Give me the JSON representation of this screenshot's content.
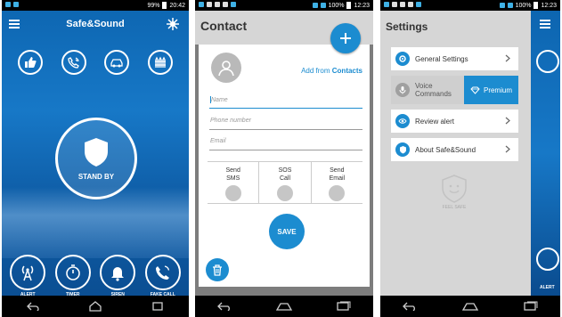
{
  "phone1": {
    "status": {
      "battery": "99%",
      "time": "20:42"
    },
    "app_title": "Safe&Sound",
    "standby_label": "STAND BY",
    "bottom_actions": [
      {
        "label": "ALERT",
        "icon": "antenna-icon"
      },
      {
        "label": "TIMER",
        "icon": "stopwatch-icon"
      },
      {
        "label": "SIREN",
        "icon": "bell-icon"
      },
      {
        "label": "FAKE CALL",
        "icon": "phone-icon"
      }
    ]
  },
  "phone2": {
    "status": {
      "battery": "100%",
      "time": "12:23"
    },
    "title": "Contact",
    "add_from_prefix": "Add from",
    "add_from_bold": "Contacts",
    "fields": {
      "name_placeholder": "Name",
      "phone_placeholder": "Phone number",
      "email_placeholder": "Email"
    },
    "options": [
      {
        "line1": "Send",
        "line2": "SMS"
      },
      {
        "line1": "SOS",
        "line2": "Call"
      },
      {
        "line1": "Send",
        "line2": "Email"
      }
    ],
    "save_label": "SAVE"
  },
  "phone3": {
    "status": {
      "battery": "100%",
      "time": "12:23"
    },
    "title": "Settings",
    "items": [
      {
        "label": "General Settings"
      },
      {
        "label": "Review alert"
      },
      {
        "label": "About Safe&Sound"
      }
    ],
    "voice_line1": "Voice",
    "voice_line2": "Commands",
    "premium_label": "Premium",
    "feel_safe": "FEEL SAFE",
    "peek_alert": "ALERT"
  },
  "colors": {
    "accent": "#1c8cd0",
    "app_blue": "#1778c7"
  }
}
